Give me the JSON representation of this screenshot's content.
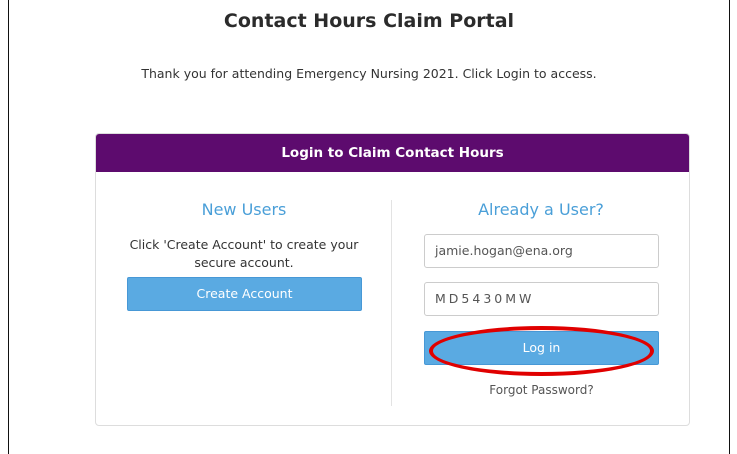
{
  "page": {
    "title": "Contact Hours Claim Portal",
    "intro": "Thank you for attending Emergency Nursing 2021. Click Login to access."
  },
  "panel": {
    "header": "Login to Claim Contact Hours",
    "new_users": {
      "heading": "New Users",
      "text": "Click 'Create Account' to create your secure account.",
      "button_label": "Create Account"
    },
    "existing": {
      "heading": "Already a User?",
      "email_value": "jamie.hogan@ena.org",
      "password_value": "MD5430MW",
      "login_label": "Log in",
      "forgot_label": "Forgot Password?"
    }
  },
  "annotation": {
    "highlight_color": "#e00000"
  },
  "colors": {
    "header_bg": "#5d0b6e",
    "accent_blue": "#5aaae2",
    "heading_blue": "#4a9fd8"
  }
}
